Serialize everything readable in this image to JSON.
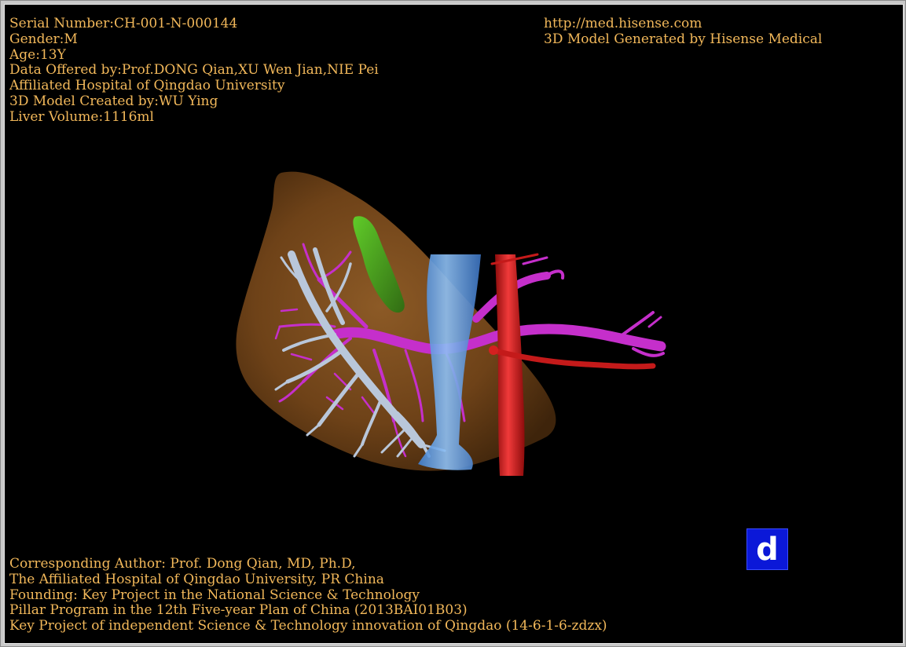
{
  "header_left": {
    "serial": "Serial Number:CH-001-N-000144",
    "gender": "Gender:M",
    "age": "Age:13Y",
    "data_offered": "Data Offered by:Prof.DONG Qian,XU Wen Jian,NIE Pei",
    "hospital": "Affiliated Hospital of Qingdao University",
    "model_created": "3D Model Created by:WU Ying",
    "liver_volume": "Liver Volume:1116ml"
  },
  "header_right": {
    "url": "http://med.hisense.com",
    "generated_by": "3D Model Generated by Hisense Medical"
  },
  "footer": {
    "line1": "Corresponding Author: Prof. Dong Qian, MD, Ph.D,",
    "line2": "The Affiliated Hospital of Qingdao University, PR China",
    "line3": "Founding: Key Project in the National Science & Technology",
    "line4": "Pillar Program in the 12th Five-year Plan of China (2013BAI01B03)",
    "line5": "Key Project of independent Science & Technology innovation of Qingdao (14-6-1-6-zdzx)"
  },
  "view_badge": {
    "label": "d",
    "color": "#0b18d8"
  },
  "colors": {
    "text": "#f2b85a",
    "liver": "#7a4a1c",
    "gallbladder": "#3fae1a",
    "portal_vein": "#c22bc8",
    "hepatic_vein": "#b8c6d8",
    "ivc": "#5a9ee6",
    "aorta": "#d41c1c"
  }
}
